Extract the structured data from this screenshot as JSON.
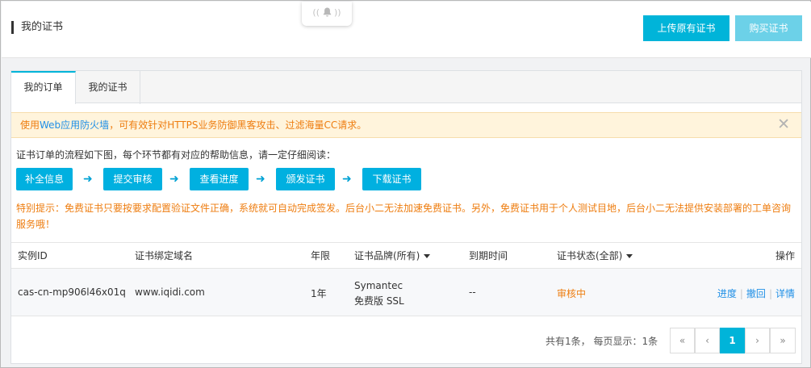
{
  "header": {
    "title": "我的证书",
    "upload_button": "上传原有证书",
    "buy_button": "购买证书"
  },
  "tabs": [
    {
      "label": "我的订单",
      "active": true
    },
    {
      "label": "我的证书",
      "active": false
    }
  ],
  "notice": {
    "prefix": "使用",
    "link": "Web应用防火墙",
    "suffix": "，可有效针对HTTPS业务防御黑客攻击、过滤海量CC请求。",
    "close": "✕"
  },
  "flow": {
    "intro": "证书订单的流程如下图，每个环节都有对应的帮助信息，请一定仔细阅读：",
    "steps": [
      "补全信息",
      "提交审核",
      "查看进度",
      "颁发证书",
      "下载证书"
    ],
    "arrow": "➜"
  },
  "warning": "特别提示：免费证书只要按要求配置验证文件正确，系统就可自动完成签发。后台小二无法加速免费证书。另外，免费证书用于个人测试目地，后台小二无法提供安装部署的工单咨询服务哦！",
  "table": {
    "columns": [
      "实例ID",
      "证书绑定域名",
      "年限",
      "证书品牌(所有)",
      "到期时间",
      "证书状态(全部)",
      "操作"
    ],
    "rows": [
      {
        "instance_id": "cas-cn-mp906l46x01q",
        "domain": "www.iqidi.com",
        "term": "1年",
        "brand_line1": "Symantec",
        "brand_line2": "免费版 SSL",
        "expire": "--",
        "status": "审核中",
        "actions": [
          "进度",
          "撤回",
          "详情"
        ]
      }
    ]
  },
  "pagination": {
    "info": "共有1条， 每页显示：1条",
    "first": "«",
    "prev": "‹",
    "current": "1",
    "next": "›",
    "last": "»"
  },
  "colors": {
    "primary": "#00b4d9",
    "warning": "#ee7d10",
    "link": "#1f8fe6"
  }
}
